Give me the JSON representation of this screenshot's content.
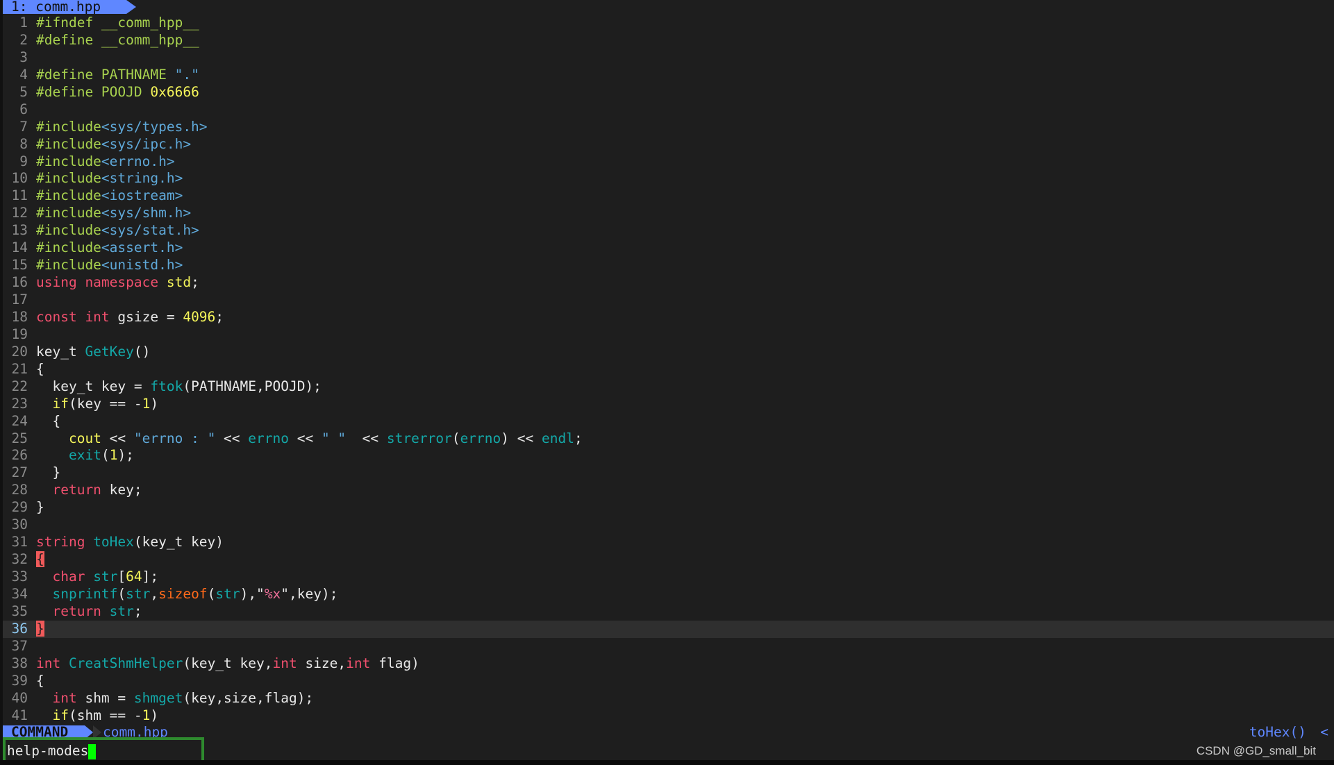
{
  "tabline": {
    "tab_label": "1: comm.hpp",
    "accent": "#5f87ff"
  },
  "editor": {
    "current_line": 36,
    "lines": [
      [
        [
          "#ifndef __comm_hpp__",
          "pp"
        ]
      ],
      [
        [
          "#define __comm_hpp__",
          "pp"
        ]
      ],
      [],
      [
        [
          "#define PATHNAME ",
          "pp"
        ],
        [
          "\".\"",
          "str"
        ]
      ],
      [
        [
          "#define POOJD ",
          "pp"
        ],
        [
          "0x6666",
          "num"
        ]
      ],
      [],
      [
        [
          "#include",
          "pp"
        ],
        [
          "<sys/types.h>",
          "hdr"
        ]
      ],
      [
        [
          "#include",
          "pp"
        ],
        [
          "<sys/ipc.h>",
          "hdr"
        ]
      ],
      [
        [
          "#include",
          "pp"
        ],
        [
          "<errno.h>",
          "hdr"
        ]
      ],
      [
        [
          "#include",
          "pp"
        ],
        [
          "<string.h>",
          "hdr"
        ]
      ],
      [
        [
          "#include",
          "pp"
        ],
        [
          "<iostream>",
          "hdr"
        ]
      ],
      [
        [
          "#include",
          "pp"
        ],
        [
          "<sys/shm.h>",
          "hdr"
        ]
      ],
      [
        [
          "#include",
          "pp"
        ],
        [
          "<sys/stat.h>",
          "hdr"
        ]
      ],
      [
        [
          "#include",
          "pp"
        ],
        [
          "<assert.h>",
          "hdr"
        ]
      ],
      [
        [
          "#include",
          "pp"
        ],
        [
          "<unistd.h>",
          "hdr"
        ]
      ],
      [
        [
          "using namespace ",
          "kw"
        ],
        [
          "std",
          "yl"
        ],
        [
          ";",
          ""
        ]
      ],
      [],
      [
        [
          "const int ",
          "kw"
        ],
        [
          "gsize = ",
          ""
        ],
        [
          "4096",
          "num"
        ],
        [
          ";",
          ""
        ]
      ],
      [],
      [
        [
          "key_t ",
          ""
        ],
        [
          "GetKey",
          "fn"
        ],
        [
          "()",
          ""
        ]
      ],
      [
        [
          "{",
          ""
        ]
      ],
      [
        [
          "  key_t key = ",
          ""
        ],
        [
          "ftok",
          "fn"
        ],
        [
          "(PATHNAME,POOJD);",
          ""
        ]
      ],
      [
        [
          "  ",
          ""
        ],
        [
          "if",
          "yl"
        ],
        [
          "(key == -",
          ""
        ],
        [
          "1",
          "num"
        ],
        [
          ")",
          ""
        ]
      ],
      [
        [
          "  {",
          ""
        ]
      ],
      [
        [
          "    ",
          ""
        ],
        [
          "cout",
          "yl"
        ],
        [
          " << ",
          ""
        ],
        [
          "\"errno : \"",
          "str"
        ],
        [
          " << ",
          ""
        ],
        [
          "errno",
          "fn"
        ],
        [
          " << ",
          ""
        ],
        [
          "\" \"",
          "str"
        ],
        [
          "  << ",
          ""
        ],
        [
          "strerror",
          "fn"
        ],
        [
          "(",
          ""
        ],
        [
          "errno",
          "fn"
        ],
        [
          ") << ",
          ""
        ],
        [
          "endl",
          "fn"
        ],
        [
          ";",
          ""
        ]
      ],
      [
        [
          "    ",
          ""
        ],
        [
          "exit",
          "fn"
        ],
        [
          "(",
          ""
        ],
        [
          "1",
          "num"
        ],
        [
          ");",
          ""
        ]
      ],
      [
        [
          "  }",
          ""
        ]
      ],
      [
        [
          "  ",
          ""
        ],
        [
          "return ",
          "kw"
        ],
        [
          "key;",
          ""
        ]
      ],
      [
        [
          "}",
          ""
        ]
      ],
      [],
      [
        [
          "string ",
          "kw"
        ],
        [
          "toHex",
          "fn"
        ],
        [
          "(key_t key)",
          ""
        ]
      ],
      [
        [
          "{",
          "mb"
        ]
      ],
      [
        [
          "  ",
          ""
        ],
        [
          "char ",
          "kw"
        ],
        [
          "str",
          "fn"
        ],
        [
          "[",
          ""
        ],
        [
          "64",
          "num"
        ],
        [
          "];",
          ""
        ]
      ],
      [
        [
          "  ",
          ""
        ],
        [
          "snprintf",
          "fn"
        ],
        [
          "(",
          ""
        ],
        [
          "str",
          "fn"
        ],
        [
          ",",
          ""
        ],
        [
          "sizeof",
          "or"
        ],
        [
          "(",
          ""
        ],
        [
          "str",
          "fn"
        ],
        [
          "),\"",
          ""
        ],
        [
          "%x",
          "fmt"
        ],
        [
          "\",key);",
          ""
        ]
      ],
      [
        [
          "  ",
          ""
        ],
        [
          "return ",
          "kw"
        ],
        [
          "str",
          "fn"
        ],
        [
          ";",
          ""
        ]
      ],
      [
        [
          "}",
          "mb"
        ]
      ],
      [],
      [
        [
          "int ",
          "kw"
        ],
        [
          "CreatShmHelper",
          "fn"
        ],
        [
          "(key_t key,",
          ""
        ],
        [
          "int ",
          "kw"
        ],
        [
          "size,",
          ""
        ],
        [
          "int ",
          "kw"
        ],
        [
          "flag)",
          ""
        ]
      ],
      [
        [
          "{",
          ""
        ]
      ],
      [
        [
          "  ",
          ""
        ],
        [
          "int ",
          "kw"
        ],
        [
          "shm = ",
          ""
        ],
        [
          "shmget",
          "fn"
        ],
        [
          "(key,size,flag);",
          ""
        ]
      ],
      [
        [
          "  ",
          ""
        ],
        [
          "if",
          "yl"
        ],
        [
          "(shm == -",
          ""
        ],
        [
          "1",
          "num"
        ],
        [
          ")",
          ""
        ]
      ]
    ]
  },
  "statusline": {
    "mode": "COMMAND",
    "filename": "comm.hpp",
    "function": "toHex()",
    "chevron": "<"
  },
  "cmdline": {
    "text": "help-modes"
  },
  "watermark": "CSDN @GD_small_bit"
}
